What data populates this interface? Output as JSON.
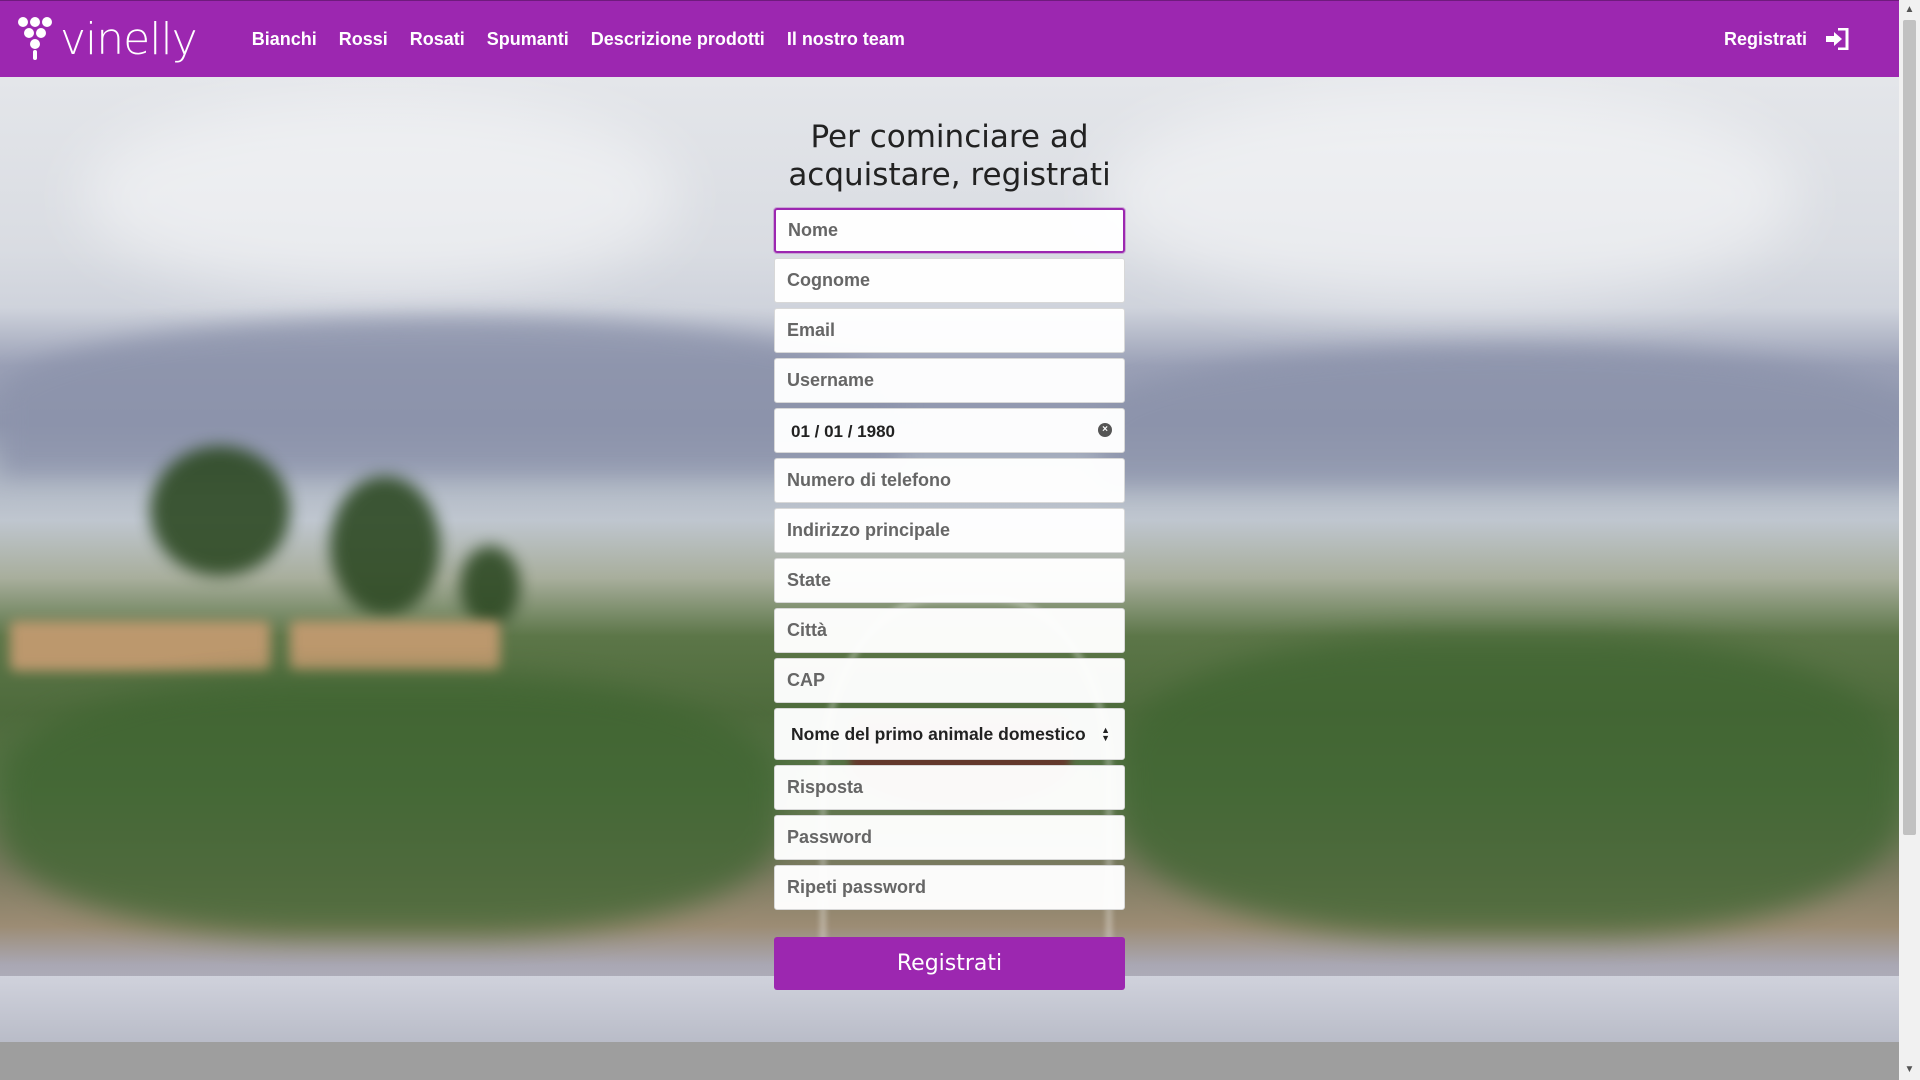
{
  "brand": {
    "name": "vinelly"
  },
  "nav": {
    "links": [
      "Bianchi",
      "Rossi",
      "Rosati",
      "Spumanti",
      "Descrizione prodotti",
      "Il nostro team"
    ],
    "register_label": "Registrati",
    "login_icon": "sign-in-icon"
  },
  "form": {
    "title_line1": "Per cominciare ad",
    "title_line2": "acquistare, registrati",
    "placeholders": {
      "nome": "Nome",
      "cognome": "Cognome",
      "email": "Email",
      "username": "Username",
      "telefono": "Numero di telefono",
      "indirizzo": "Indirizzo principale",
      "state": "State",
      "citta": "Città",
      "cap": "CAP",
      "risposta": "Risposta",
      "password": "Password",
      "ripeti_password": "Ripeti password"
    },
    "birth_date": "01 / 01 / 1980",
    "security_question": "Nome del primo animale domestico",
    "submit_label": "Registrati"
  },
  "colors": {
    "accent": "#9c27b0",
    "accent_dark": "#6f1a7d"
  }
}
